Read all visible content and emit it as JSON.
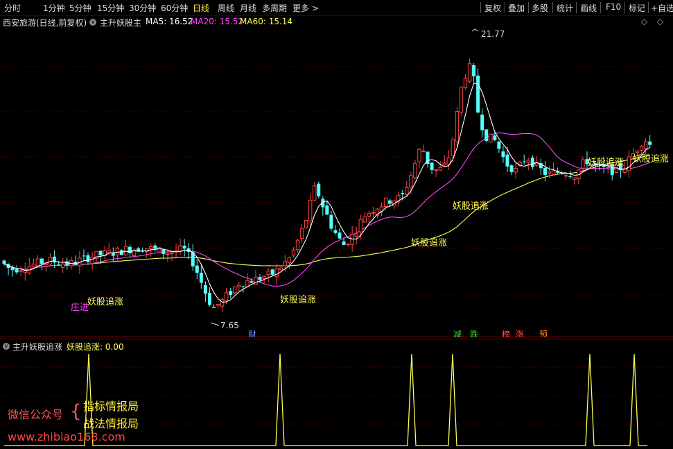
{
  "toolbar": {
    "periods": [
      "分时",
      "1分钟",
      "5分钟",
      "15分钟",
      "30分钟",
      "60分钟",
      "日线",
      "周线",
      "月线",
      "多周期",
      "更多 >"
    ],
    "active_period": "日线",
    "right_buttons": [
      "复权",
      "叠加",
      "多股",
      "统计",
      "画线",
      "F10",
      "标记",
      "+自选"
    ]
  },
  "info": {
    "stock_title": "西安旅游(日线,前复权)",
    "indicator_name": "主升妖股主",
    "ma5_label": "MA5: 16.52",
    "ma20_label": "MA20: 15.52",
    "ma60_label": "MA60: 15.14",
    "diamond": "◇",
    "dropdown": "◇"
  },
  "colors": {
    "up": "#ff4444",
    "down": "#54ffff",
    "ma5": "#ffffff",
    "ma20": "#ff44ff",
    "ma60": "#ffff55",
    "signal": "#ffff55",
    "grid": "#5a0000"
  },
  "chart_annotations": {
    "high_price": "21.77",
    "low_price": "7.65",
    "signal_label": "妖股追涨",
    "entry_label": "庄进",
    "event_markers": [
      {
        "text": "财",
        "color": "#5599ff"
      },
      {
        "text": "减",
        "color": "#33dd33"
      },
      {
        "text": "跌",
        "color": "#33dd33"
      },
      {
        "text": "榜",
        "color": "#ff5555"
      },
      {
        "text": "涨",
        "color": "#ff5555"
      },
      {
        "text": "预",
        "color": "#ff8800"
      }
    ]
  },
  "indicator": {
    "title": "主升妖股追涨",
    "value_label": "妖股追涨: 0.00"
  },
  "watermark": {
    "wechat_label": "微信公众号",
    "brace": "{",
    "line1": "指标情报局",
    "line2": "战法情报局",
    "url": "www.zhibiao168.com"
  }
}
